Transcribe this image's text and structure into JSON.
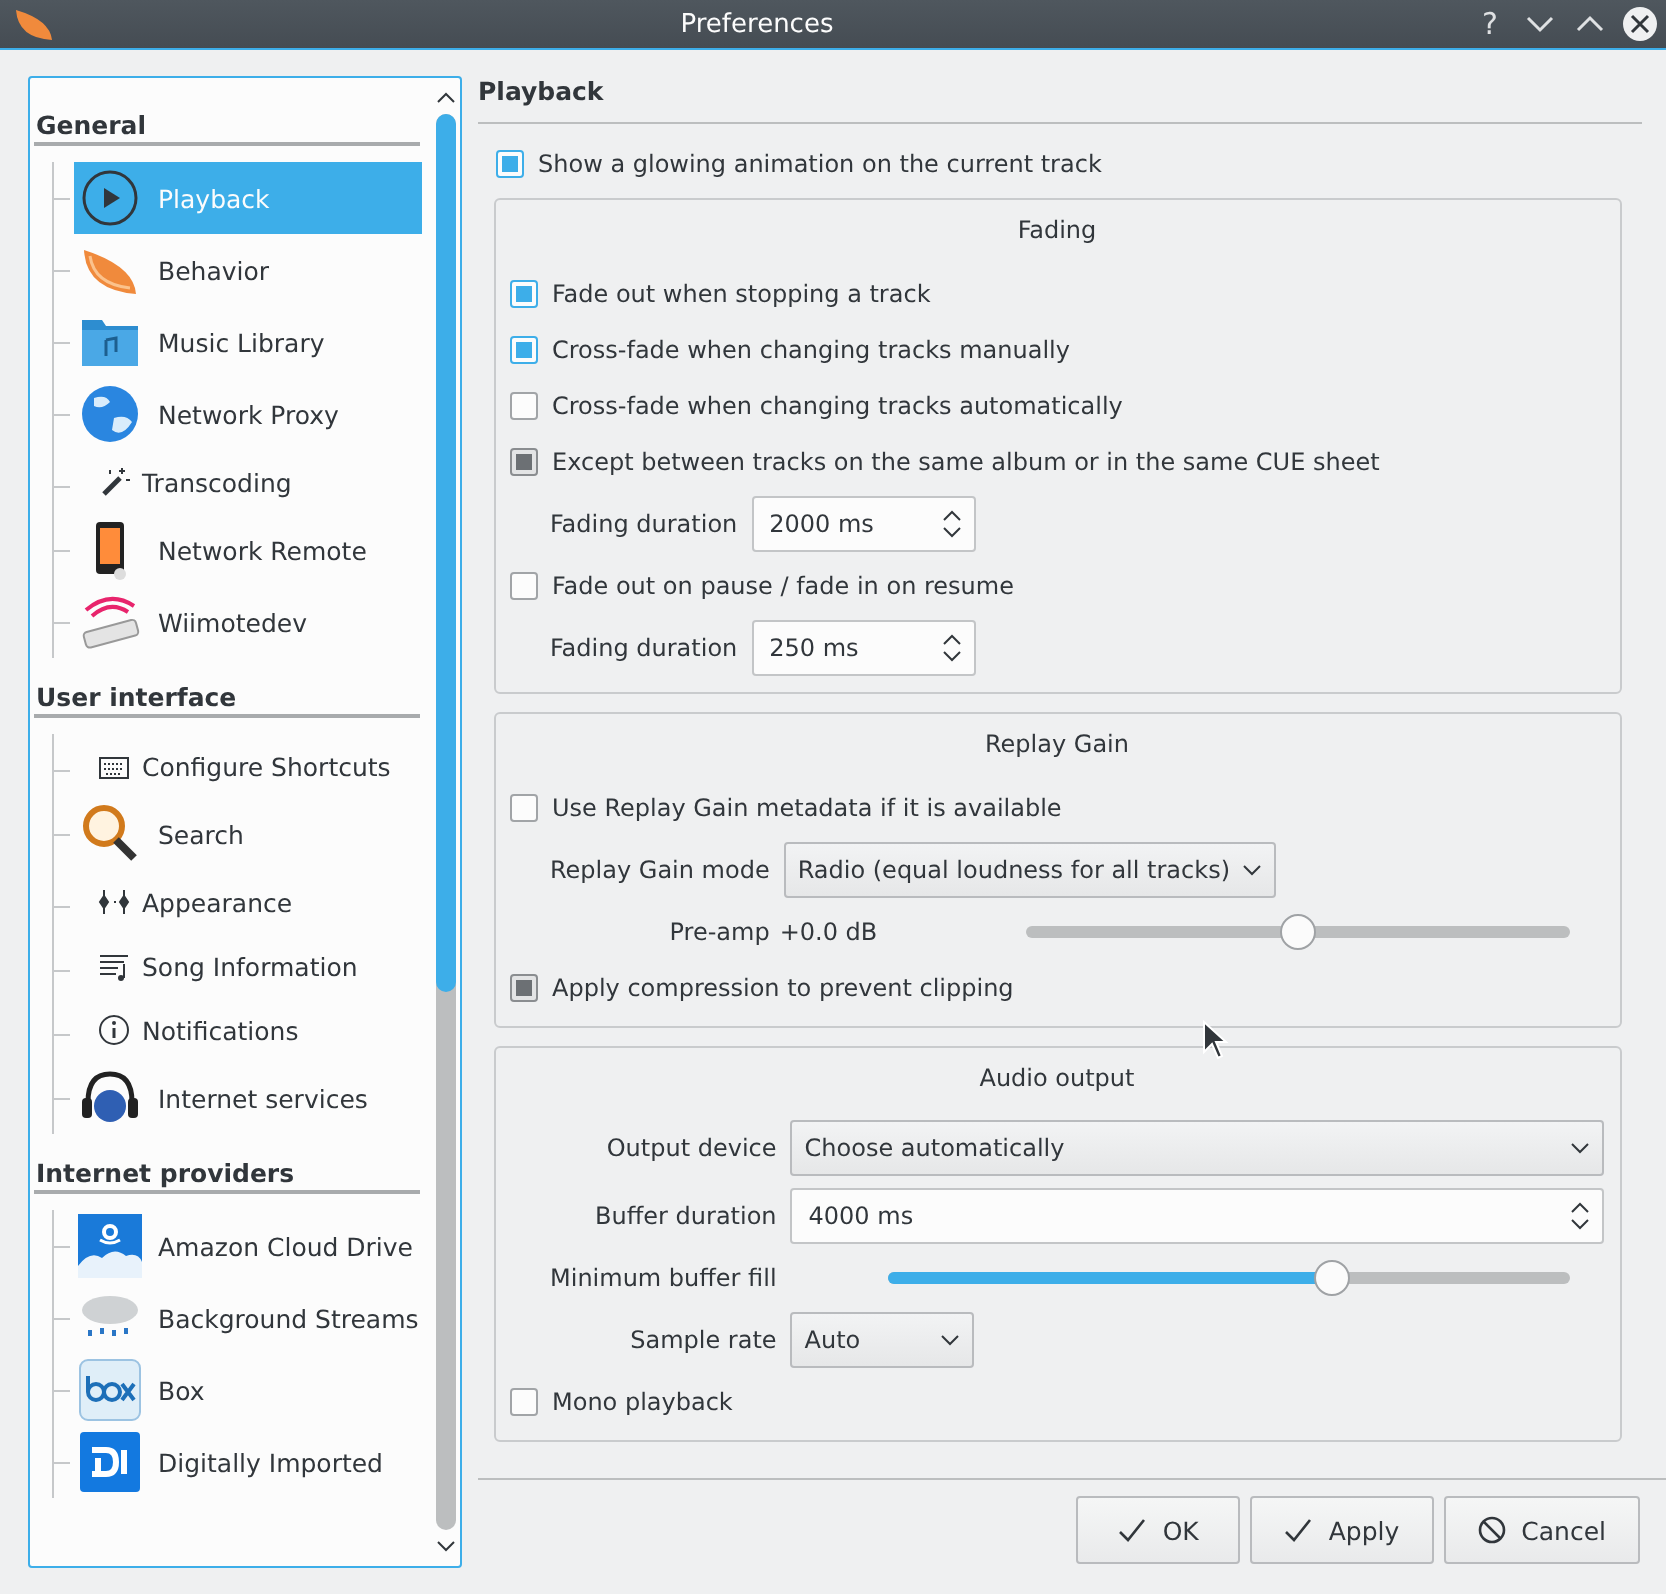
{
  "window": {
    "title": "Preferences",
    "help": "?"
  },
  "sidebar": {
    "groups": [
      {
        "title": "General",
        "items": [
          {
            "label": "Playback",
            "selected": true
          },
          {
            "label": "Behavior",
            "selected": false
          },
          {
            "label": "Music Library",
            "selected": false
          },
          {
            "label": "Network Proxy",
            "selected": false
          },
          {
            "label": "Transcoding",
            "selected": false
          },
          {
            "label": "Network Remote",
            "selected": false
          },
          {
            "label": "Wiimotedev",
            "selected": false
          }
        ]
      },
      {
        "title": "User interface",
        "items": [
          {
            "label": "Configure Shortcuts",
            "selected": false
          },
          {
            "label": "Search",
            "selected": false
          },
          {
            "label": "Appearance",
            "selected": false
          },
          {
            "label": "Song Information",
            "selected": false
          },
          {
            "label": "Notifications",
            "selected": false
          },
          {
            "label": "Internet services",
            "selected": false
          }
        ]
      },
      {
        "title": "Internet providers",
        "items": [
          {
            "label": "Amazon Cloud Drive",
            "selected": false
          },
          {
            "label": "Background Streams",
            "selected": false
          },
          {
            "label": "Box",
            "selected": false
          },
          {
            "label": "Digitally Imported",
            "selected": false
          }
        ]
      }
    ]
  },
  "page": {
    "title": "Playback",
    "glow": {
      "label": "Show a glowing animation on the current track",
      "checked": true,
      "disabled": false
    },
    "sections": [
      {
        "title": "Fading",
        "rows": [
          {
            "kind": "checkbox",
            "label": "Fade out when stopping a track",
            "checked": true,
            "disabled": false
          },
          {
            "kind": "checkbox",
            "label": "Cross-fade when changing tracks manually",
            "checked": true,
            "disabled": false
          },
          {
            "kind": "checkbox",
            "label": "Cross-fade when changing tracks automatically",
            "checked": false
          },
          {
            "kind": "checkbox",
            "label": "Except between tracks on the same album or in the same CUE sheet",
            "checked": true,
            "disabled": true
          },
          {
            "kind": "spin",
            "label": "Fading duration",
            "value": "2000 ms"
          },
          {
            "kind": "checkbox",
            "label": "Fade out on pause / fade in on resume",
            "checked": false
          },
          {
            "kind": "spin",
            "label": "Fading duration",
            "value": "250 ms"
          }
        ]
      },
      {
        "title": "Replay Gain",
        "rows": [
          {
            "kind": "checkbox",
            "label": "Use Replay Gain metadata if it is available",
            "checked": false
          },
          {
            "kind": "combo",
            "label": "Replay Gain mode",
            "value": "Radio (equal loudness for all tracks)"
          },
          {
            "kind": "slider",
            "label": "Pre-amp",
            "reading": "+0.0 dB",
            "level": 0.5,
            "disabled": true
          },
          {
            "kind": "checkbox",
            "label": "Apply compression to prevent clipping",
            "checked": true,
            "disabled": true
          }
        ]
      },
      {
        "title": "Audio output",
        "rows": [
          {
            "kind": "combo",
            "label": "Output device",
            "value": "Choose automatically"
          },
          {
            "kind": "spin",
            "label": "Buffer duration",
            "value": "4000 ms"
          },
          {
            "kind": "slider",
            "label": "Minimum buffer fill",
            "level": 0.65,
            "disabled": false
          },
          {
            "kind": "combo",
            "label": "Sample rate",
            "value": "Auto"
          },
          {
            "kind": "checkbox",
            "label": "Mono playback",
            "checked": false
          }
        ]
      }
    ]
  },
  "buttons": [
    {
      "kind": "ok",
      "label": "OK"
    },
    {
      "kind": "apply",
      "label": "Apply"
    },
    {
      "kind": "cancel",
      "label": "Cancel"
    }
  ]
}
